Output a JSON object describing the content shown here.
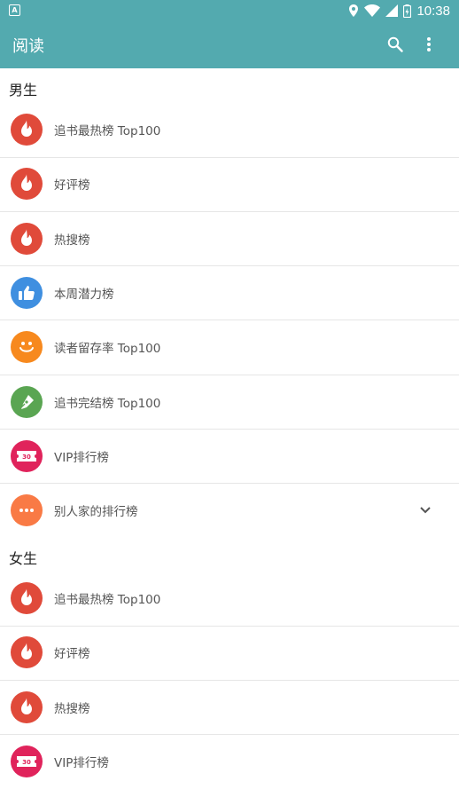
{
  "status_bar": {
    "left_badge": "A",
    "time": "10:38",
    "icons": [
      "location-icon",
      "wifi-icon",
      "signal-icon",
      "battery-icon"
    ]
  },
  "appbar": {
    "title": "阅读",
    "icons": [
      "search-icon",
      "more-vert-icon"
    ]
  },
  "colors": {
    "primary": "#53aaaf",
    "fire_red": "#e04a3a",
    "thumb_blue": "#3f8fe0",
    "smile_orange": "#f7891e",
    "pen_green": "#5aa552",
    "vip_pink": "#e0235b",
    "more_orange": "#f97a45"
  },
  "sections": [
    {
      "title": "男生",
      "items": [
        {
          "label": "追书最热榜 Top100",
          "icon": "fire-icon"
        },
        {
          "label": "好评榜",
          "icon": "fire-icon"
        },
        {
          "label": "热搜榜",
          "icon": "fire-icon"
        },
        {
          "label": "本周潜力榜",
          "icon": "thumbs-up-icon"
        },
        {
          "label": "读者留存率 Top100",
          "icon": "smile-icon"
        },
        {
          "label": "追书完结榜 Top100",
          "icon": "pen-icon"
        },
        {
          "label": "VIP排行榜",
          "icon": "ticket-icon",
          "ticket_text": "30"
        },
        {
          "label": "别人家的排行榜",
          "icon": "more-dots-icon"
        }
      ]
    },
    {
      "title": "女生",
      "items": [
        {
          "label": "追书最热榜 Top100",
          "icon": "fire-icon"
        },
        {
          "label": "好评榜",
          "icon": "fire-icon"
        },
        {
          "label": "热搜榜",
          "icon": "fire-icon"
        },
        {
          "label": "VIP排行榜",
          "icon": "ticket-icon",
          "ticket_text": "30"
        }
      ]
    }
  ]
}
